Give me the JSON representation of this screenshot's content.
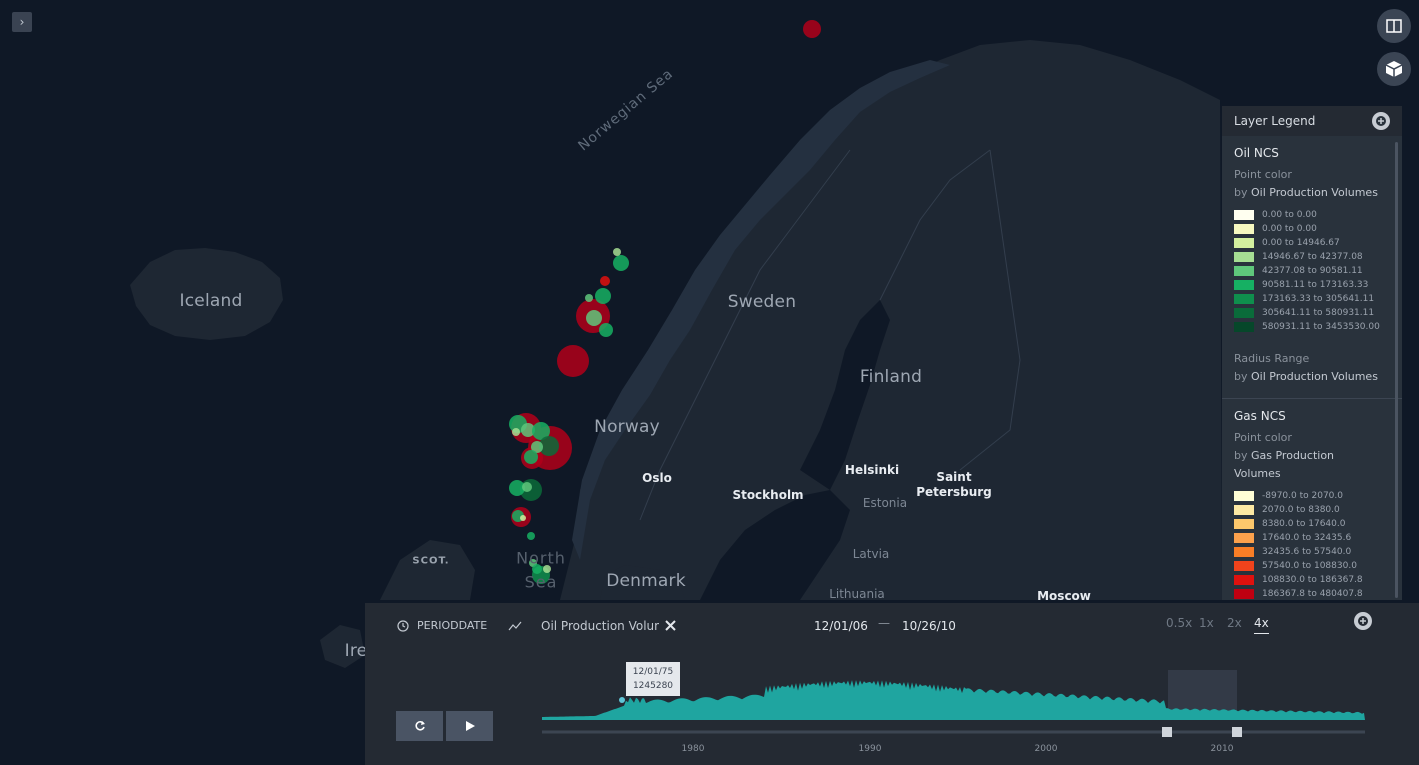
{
  "map": {
    "countries": [
      "Iceland",
      "Sweden",
      "Norway",
      "Finland",
      "Denmark",
      "Ire"
    ],
    "cities": [
      "Oslo",
      "Stockholm",
      "Helsinki",
      "Saint",
      "Petersburg",
      "Moscow"
    ],
    "regions": [
      "Estonia",
      "Latvia",
      "Lithuania",
      "SCOT.",
      "North",
      "Sea"
    ],
    "sea": "Norwegian Sea"
  },
  "controls": {
    "sidebar_toggle": "›",
    "icons": [
      "chevron-right-icon",
      "split-view-icon",
      "3d-cube-icon"
    ]
  },
  "legend": {
    "title": "Layer Legend",
    "layers": [
      {
        "name": "Oil NCS",
        "point_color": "Point color",
        "by_prefix": "by",
        "by_field": "Oil Production Volumes",
        "entries": [
          {
            "label": "0.00 to 0.00",
            "color": "#fffff0"
          },
          {
            "label": "0.00 to 0.00",
            "color": "#f6f8c0"
          },
          {
            "label": "0.00 to 14946.67",
            "color": "#d3ef9e"
          },
          {
            "label": "14946.67 to 42377.08",
            "color": "#a6de93"
          },
          {
            "label": "42377.08 to 90581.11",
            "color": "#5fc77b"
          },
          {
            "label": "90581.11 to 173163.33",
            "color": "#16b063"
          },
          {
            "label": "173163.33 to 305641.11",
            "color": "#0f8f4d"
          },
          {
            "label": "305641.11 to 580931.11",
            "color": "#0a6b3a"
          },
          {
            "label": "580931.11 to 3453530.00",
            "color": "#06472a"
          }
        ],
        "radius_label": "Radius Range",
        "radius_by_field": "Oil Production Volumes"
      },
      {
        "name": "Gas NCS",
        "point_color": "Point color",
        "by_prefix": "by",
        "by_field": "Gas Production Volumes",
        "entries": [
          {
            "label": "-8970.0 to 2070.0",
            "color": "#fffed6"
          },
          {
            "label": "2070.0 to 8380.0",
            "color": "#fde9a3"
          },
          {
            "label": "8380.0 to 17640.0",
            "color": "#fdc86c"
          },
          {
            "label": "17640.0 to 32435.6",
            "color": "#fca14c"
          },
          {
            "label": "32435.6 to 57540.0",
            "color": "#f97e26"
          },
          {
            "label": "57540.0 to 108830.0",
            "color": "#f0431c"
          },
          {
            "label": "108830.0 to 186367.8",
            "color": "#e0110e"
          },
          {
            "label": "186367.8 to 480407.8",
            "color": "#bf0011"
          }
        ]
      }
    ]
  },
  "timeline": {
    "filter_field": "PERIODDATE",
    "series_field": "Oil Production Volume",
    "range_start": "12/01/06",
    "range_end": "10/26/10",
    "range_dash": "—",
    "speeds": [
      "0.5x",
      "1x",
      "2x",
      "4x"
    ],
    "active_speed": "4x",
    "x_ticks": [
      "1980",
      "1990",
      "2000",
      "2010"
    ],
    "hover_date": "12/01/75",
    "hover_value": "1245280",
    "accent_color": "#1fa5a0"
  }
}
